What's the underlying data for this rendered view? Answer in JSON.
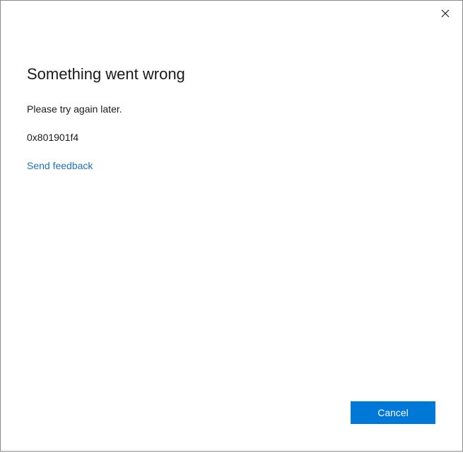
{
  "dialog": {
    "title": "Something went wrong",
    "message": "Please try again later.",
    "error_code": "0x801901f4",
    "feedback_link": "Send feedback",
    "cancel_label": "Cancel",
    "close_icon": "close-icon"
  },
  "colors": {
    "accent": "#0078d7",
    "link": "#1d6fc2",
    "border": "#8a8a8a"
  }
}
